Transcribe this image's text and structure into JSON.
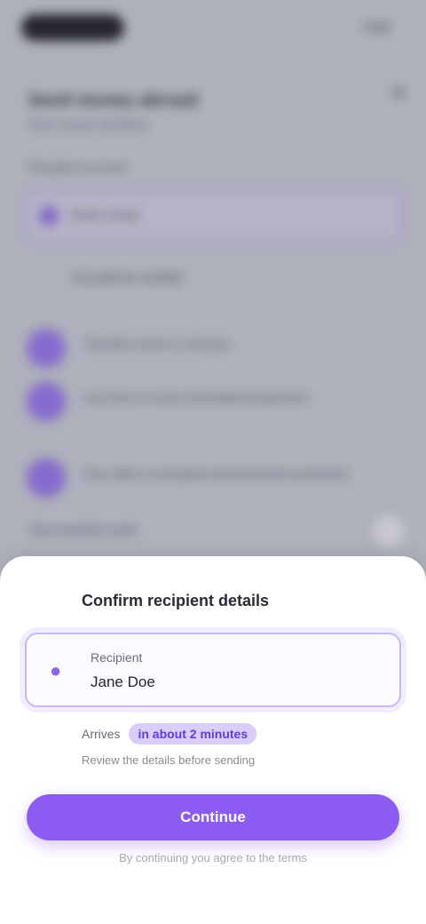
{
  "background": {
    "top_right": "Help",
    "title": "Send money abroad",
    "subtitle": "Fast, secure transfers",
    "field_label": "Recipient account",
    "input_placeholder": "Enter email",
    "link": "Use phone number",
    "rows": [
      "Transfers arrive in minutes",
      "Low fees on every international payment",
      "Your data is encrypted and protected at all times"
    ],
    "bottom_text": "How transfers work"
  },
  "sheet": {
    "title": "Confirm recipient details",
    "input_label": "Recipient",
    "input_value": "Jane Doe",
    "info_prefix": "Arrives",
    "info_highlight": "in about 2 minutes",
    "note": "Review the details before sending",
    "primary_label": "Continue",
    "footer": "By continuing you agree to the terms"
  },
  "colors": {
    "accent": "#8c5cf2",
    "accent_soft": "#d9cdfb"
  }
}
